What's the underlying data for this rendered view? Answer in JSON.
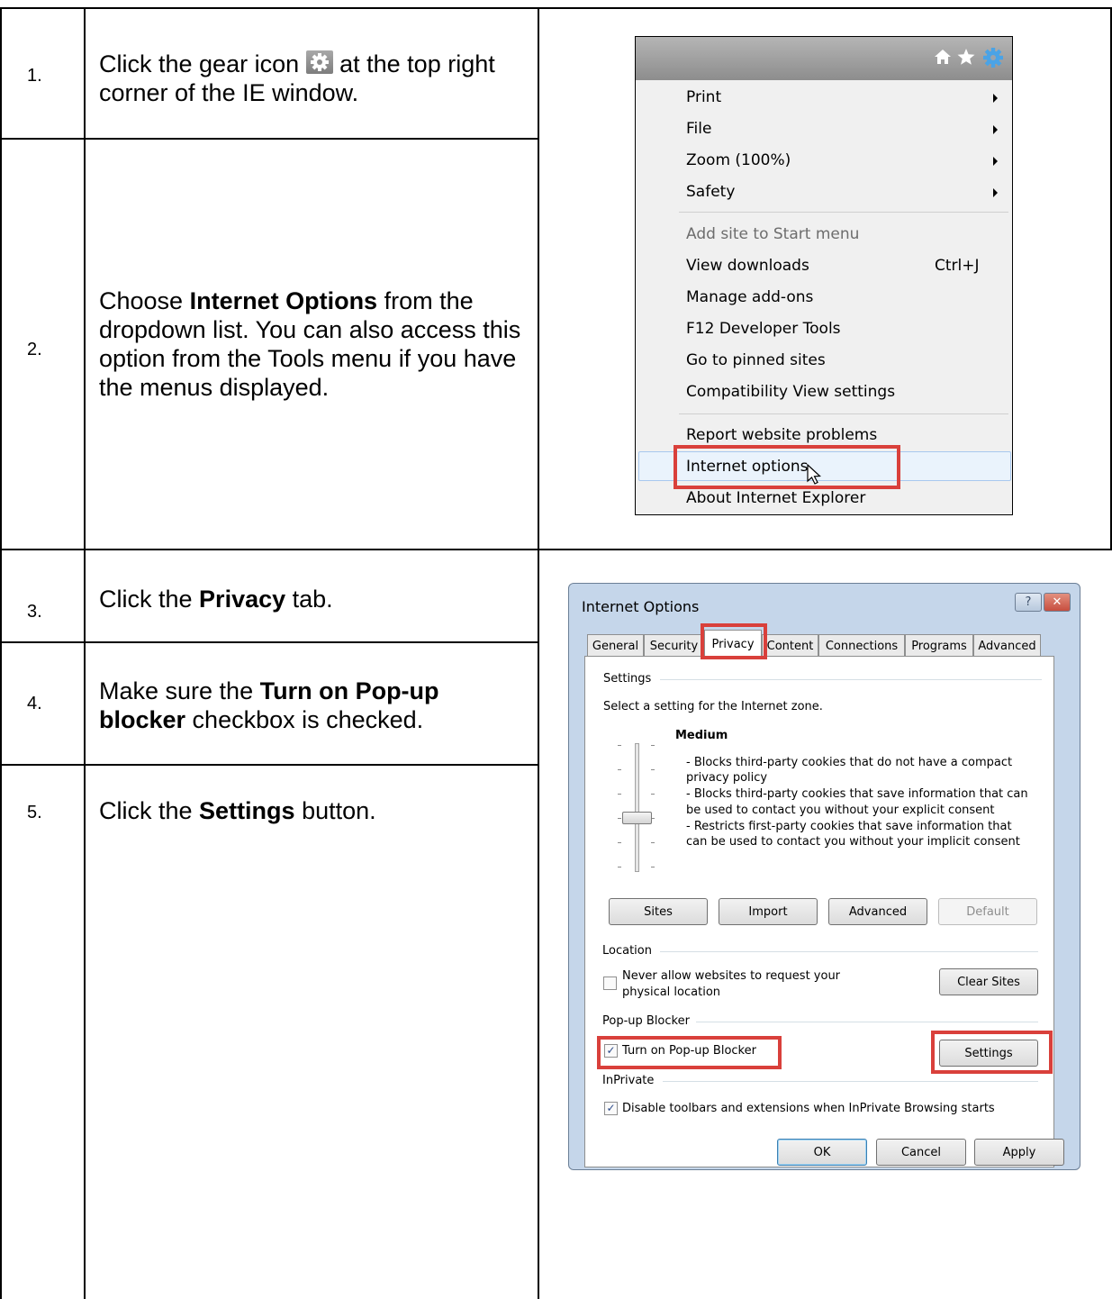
{
  "steps": [
    {
      "number": "1.",
      "text_before": "Click the gear icon",
      "text_after": " at the top right corner of the IE window."
    },
    {
      "number": "2.",
      "text_before": "Choose ",
      "bold": "Internet Options",
      "text_after": " from the dropdown list. You can also access this option from the Tools menu if you have the menus displayed."
    },
    {
      "number": "3.",
      "text_before": "Click the ",
      "bold": "Privacy",
      "text_after": " tab."
    },
    {
      "number": "4.",
      "text_before": "Make sure the ",
      "bold": "Turn on Pop-up blocker",
      "text_after": " checkbox is checked."
    },
    {
      "number": "5.",
      "text_before": "Click the ",
      "bold": "Settings",
      "text_after": " button."
    }
  ],
  "ie_menu": {
    "toolbar_icons": [
      "home-icon",
      "favorites-star-icon",
      "gear-icon"
    ],
    "items": [
      {
        "label": "Print",
        "submenu": true
      },
      {
        "label": "File",
        "submenu": true
      },
      {
        "label": "Zoom (100%)",
        "submenu": true
      },
      {
        "label": "Safety",
        "submenu": true
      },
      {
        "label": "Add site to Start menu",
        "disabled": true
      },
      {
        "label": "View downloads",
        "shortcut": "Ctrl+J"
      },
      {
        "label": "Manage add-ons"
      },
      {
        "label": "F12 Developer Tools"
      },
      {
        "label": "Go to pinned sites"
      },
      {
        "label": "Compatibility View settings"
      },
      {
        "label": "Report website problems"
      },
      {
        "label": "Internet options",
        "highlighted": true
      },
      {
        "label": "About Internet Explorer"
      }
    ]
  },
  "dialog": {
    "title": "Internet Options",
    "help_button": "?",
    "close_button": "✕",
    "tabs": [
      "General",
      "Security",
      "Privacy",
      "Content",
      "Connections",
      "Programs",
      "Advanced"
    ],
    "active_tab": "Privacy",
    "settings": {
      "group": "Settings",
      "zone_text": "Select a setting for the Internet zone.",
      "level": "Medium",
      "description": [
        "- Blocks third-party cookies that do not have a compact",
        "privacy policy",
        "- Blocks third-party cookies that save information that can",
        "be used to contact you without your explicit consent",
        "- Restricts first-party cookies that save information that",
        "can be used to contact you without your implicit consent"
      ],
      "buttons": [
        {
          "label": "Sites"
        },
        {
          "label": "Import"
        },
        {
          "label": "Advanced"
        },
        {
          "label": "Default",
          "disabled": true
        }
      ]
    },
    "location": {
      "group": "Location",
      "checkbox_label": [
        "Never allow websites to request your",
        "physical location"
      ],
      "checked": false,
      "button": "Clear Sites"
    },
    "popup_blocker": {
      "group": "Pop-up Blocker",
      "checkbox_label": "Turn on Pop-up Blocker",
      "checked": true,
      "button": "Settings"
    },
    "inprivate": {
      "group": "InPrivate",
      "checkbox_label": "Disable toolbars and extensions when InPrivate Browsing starts",
      "checked": true
    },
    "footer_buttons": [
      "OK",
      "Cancel",
      "Apply"
    ],
    "check_mark": "✓"
  },
  "colors": {
    "highlight_red": "#d9403b",
    "dialog_frame": "#c5d6ea",
    "close_button": "#c74e3f",
    "gear_blue": "#4aa3e6"
  }
}
